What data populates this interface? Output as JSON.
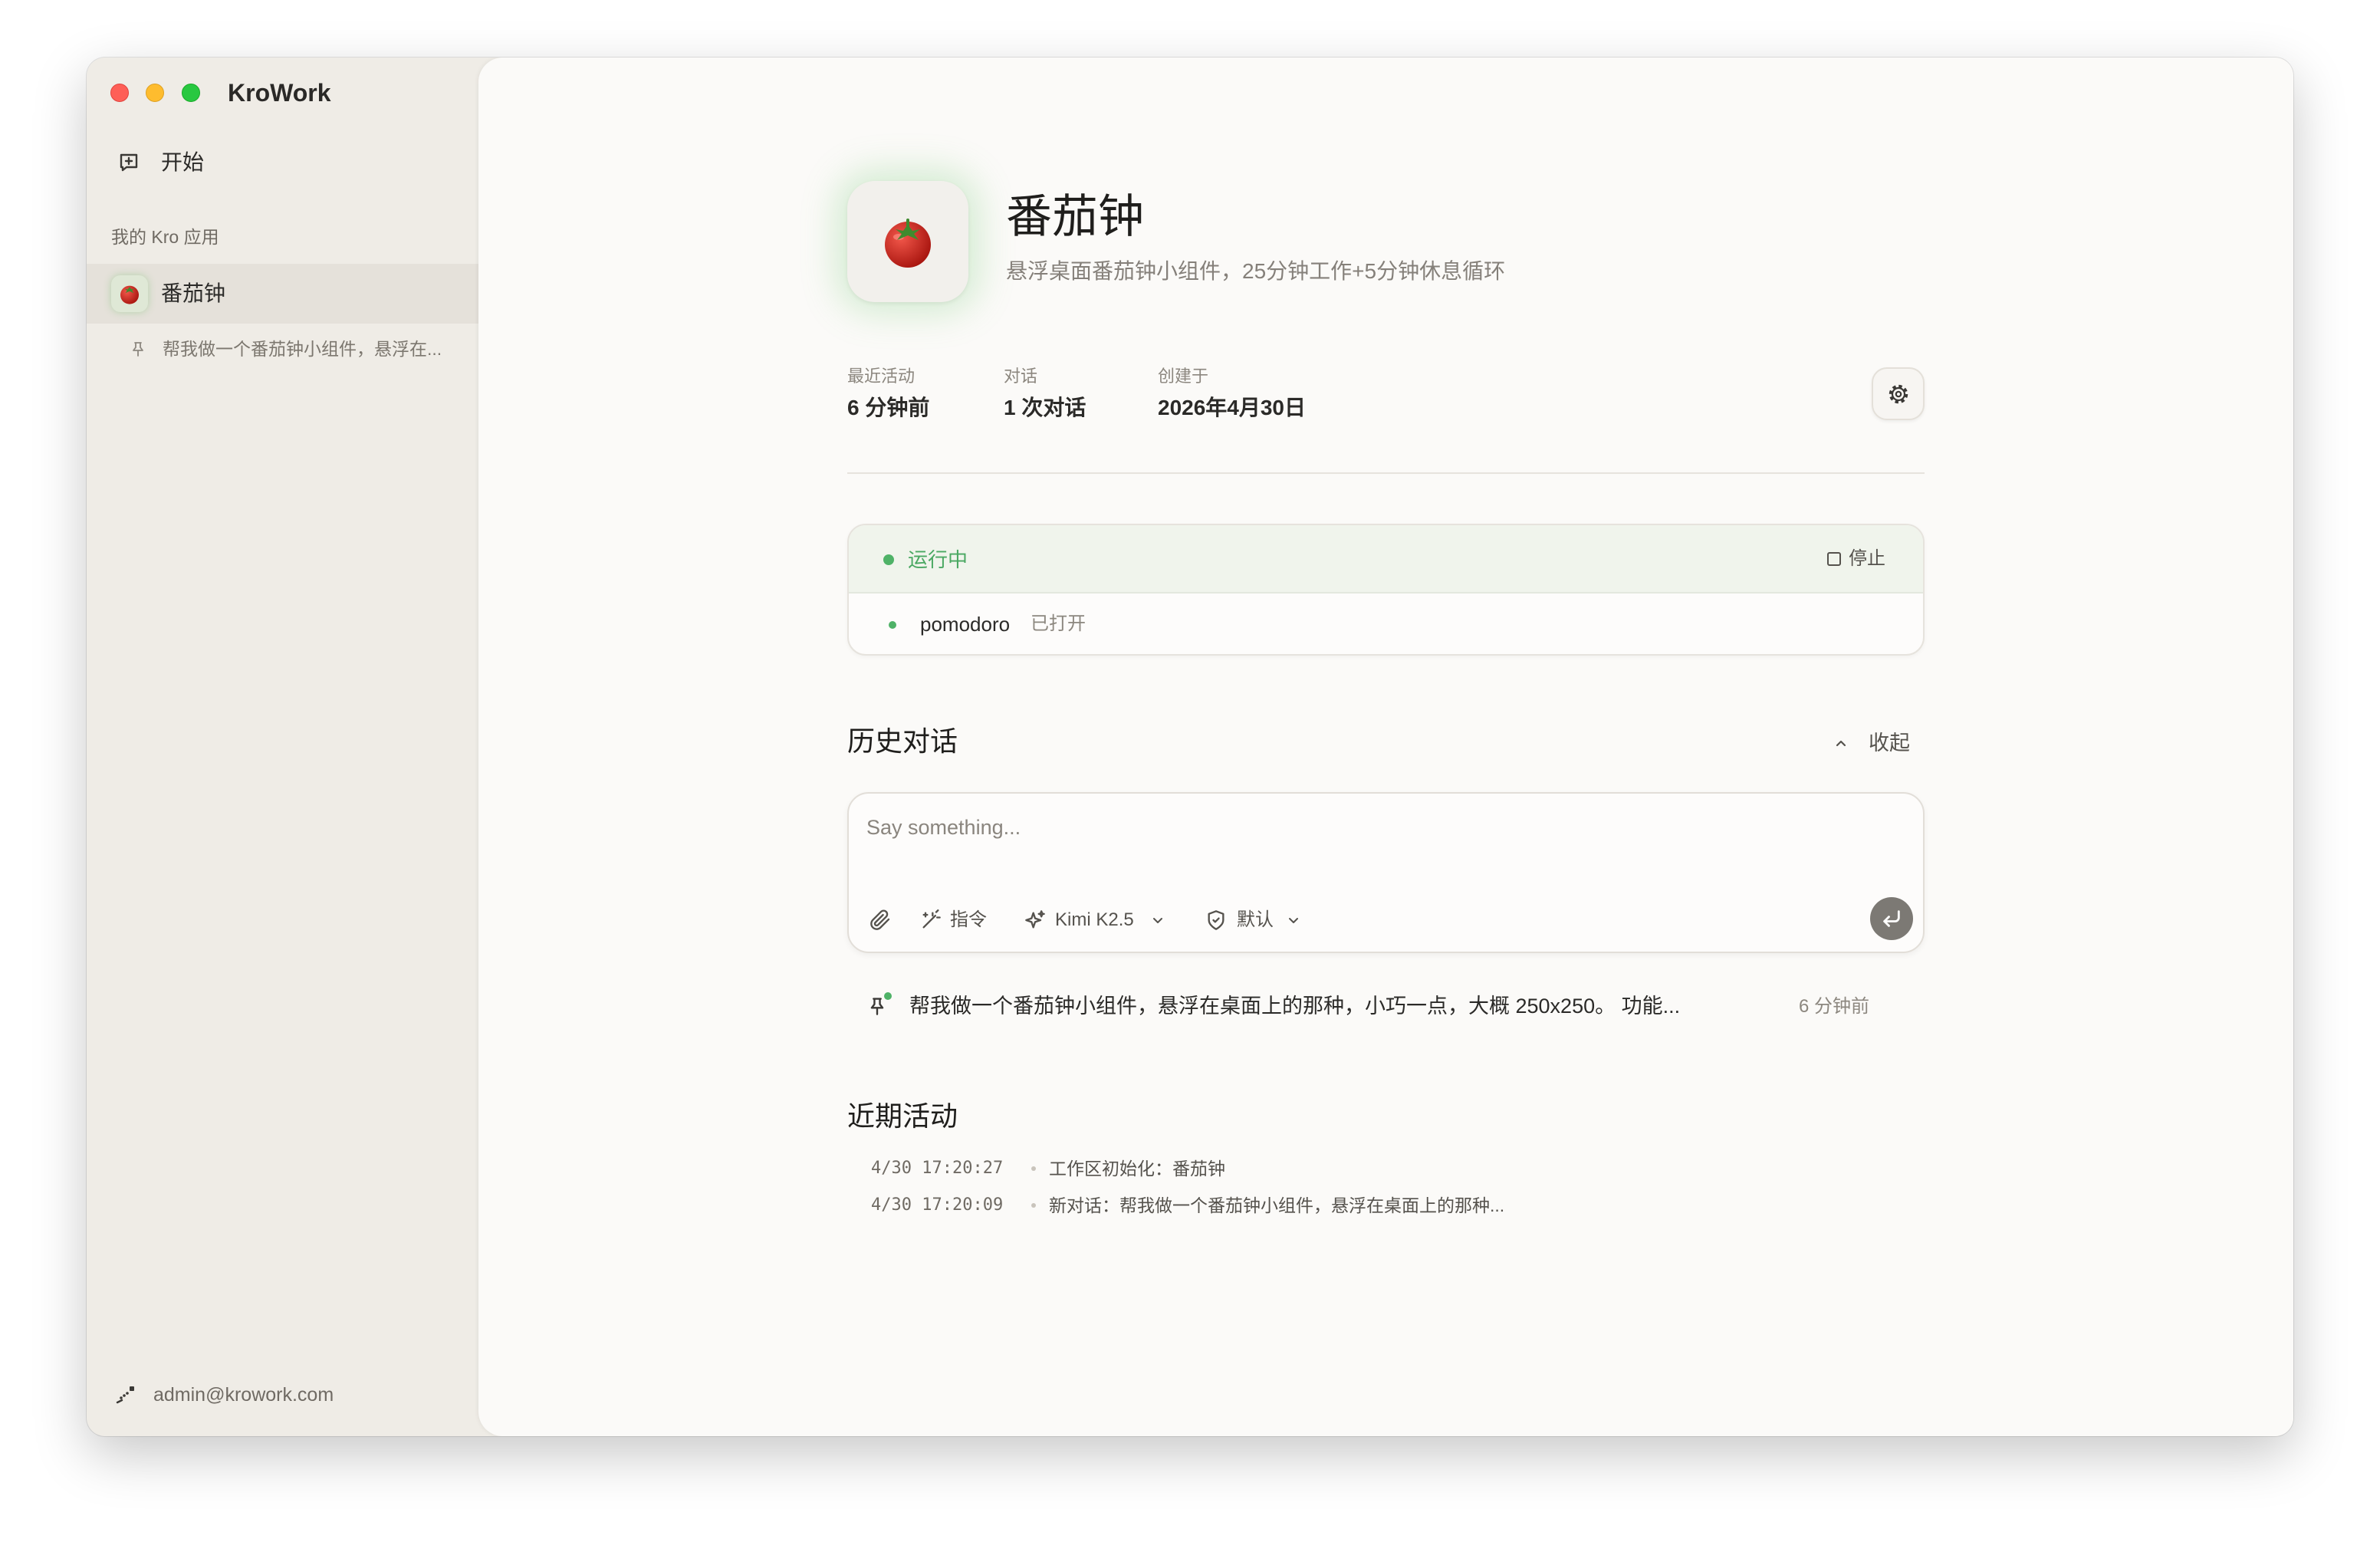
{
  "window": {
    "app_title": "KroWork"
  },
  "sidebar": {
    "start_label": "开始",
    "start_icon": "new-chat-icon",
    "section_title": "我的 Kro 应用",
    "apps": [
      {
        "name": "番茄钟",
        "icon": "tomato-icon",
        "selected": true
      }
    ],
    "sub_items": [
      {
        "text": "帮我做一个番茄钟小组件，悬浮在...",
        "icon": "pin-icon"
      }
    ],
    "user_email": "admin@krowork.com",
    "user_icon": "connection-icon"
  },
  "app": {
    "icon": "tomato-icon",
    "name": "番茄钟",
    "description": "悬浮桌面番茄钟小组件，25分钟工作+5分钟休息循环",
    "stats": [
      {
        "label": "最近活动",
        "value": "6 分钟前"
      },
      {
        "label": "对话",
        "value": "1 次对话"
      },
      {
        "label": "创建于",
        "value": "2026年4月30日"
      }
    ],
    "settings_icon": "gear-icon"
  },
  "status": {
    "label": "运行中",
    "stop_label": "停止",
    "processes": [
      {
        "name": "pomodoro",
        "state": "已打开"
      }
    ]
  },
  "history": {
    "title": "历史对话",
    "collapse_label": "收起",
    "input_placeholder": "Say something...",
    "toolbar": {
      "attach_icon": "paperclip-icon",
      "command_label": "指令",
      "model_label": "Kimi K2.5",
      "permission_label": "默认"
    },
    "conversations": [
      {
        "text": "帮我做一个番茄钟小组件，悬浮在桌面上的那种，小巧一点，大概 250x250。 功能...",
        "time": "6 分钟前"
      }
    ]
  },
  "activity": {
    "title": "近期活动",
    "items": [
      {
        "time": "4/30 17:20:27",
        "text": "工作区初始化：番茄钟"
      },
      {
        "time": "4/30 17:20:09",
        "text": "新对话：帮我做一个番茄钟小组件，悬浮在桌面上的那种..."
      }
    ]
  },
  "colors": {
    "sidebar_bg": "#efece6",
    "main_bg": "#fbfaf8",
    "selected_row": "#e5e1da",
    "accent_green": "#4fb267",
    "running_bg": "#f0f4ec"
  }
}
